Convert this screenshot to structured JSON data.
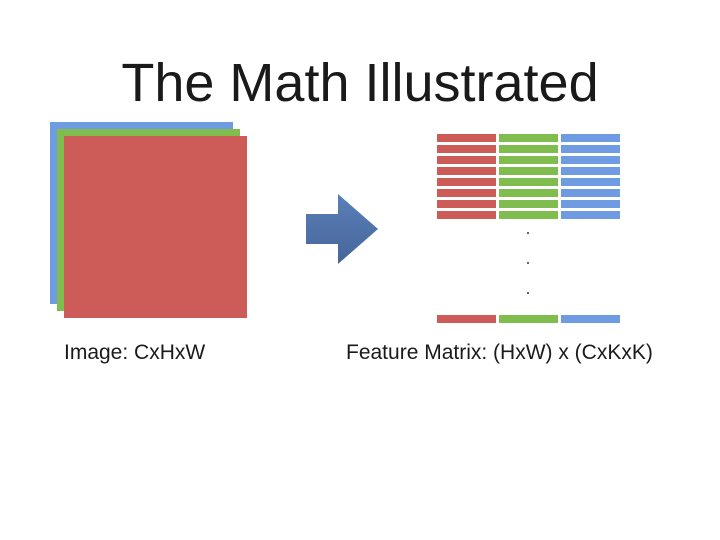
{
  "title": "The Math Illustrated",
  "image_label": "Image: CxHxW",
  "matrix_label": "Feature Matrix: (HxW) x (CxKxK)",
  "colors": {
    "blue": "#6f9be3",
    "green": "#7fbd4f",
    "red": "#cd5b57"
  },
  "arrow_icon": "right-arrow-icon"
}
